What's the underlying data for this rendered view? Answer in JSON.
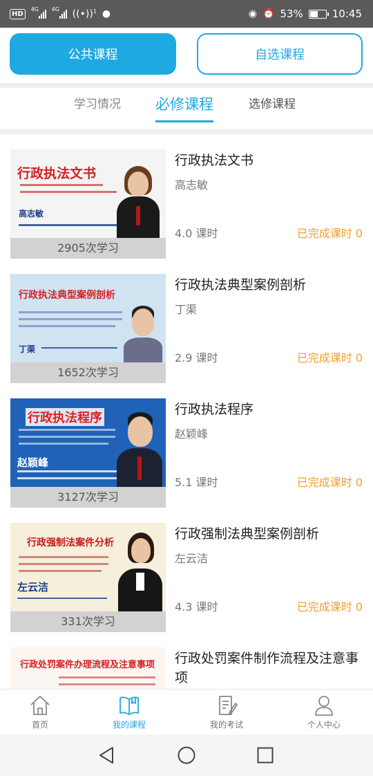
{
  "status_bar": {
    "hd_label": "HD",
    "network_1": "4G",
    "network_2": "4G",
    "hotspot_count": "1",
    "battery": "53%",
    "battery_level": 0.53,
    "time": "10:45"
  },
  "top_toggle": {
    "public_label": "公共课程",
    "custom_label": "自选课程"
  },
  "sub_tabs": {
    "study": "学习情况",
    "required": "必修课程",
    "elective": "选修课程",
    "active": "required"
  },
  "courses": [
    {
      "title": "行政执法文书",
      "author": "高志敏",
      "hours": "4.0 课时",
      "completed": "已完成课时 0",
      "study_count": "2905次学习",
      "banner": {
        "heading": "行政执法文书",
        "name": "高志敏",
        "bg": "#f4f4f4",
        "heading_color": "#d42020"
      }
    },
    {
      "title": "行政执法典型案例剖析",
      "author": "丁渠",
      "hours": "2.9 课时",
      "completed": "已完成课时 0",
      "study_count": "1652次学习",
      "banner": {
        "heading": "行政执法典型案例剖析",
        "name": "丁渠",
        "bg": "#cfe3f1",
        "heading_color": "#d42020"
      }
    },
    {
      "title": "行政执法程序",
      "author": "赵颖峰",
      "hours": "5.1 课时",
      "completed": "已完成课时 0",
      "study_count": "3127次学习",
      "banner": {
        "heading": "行政执法程序",
        "name": "赵颖峰",
        "bg": "#1f62b8",
        "heading_color": "#e02020"
      }
    },
    {
      "title": "行政强制法典型案例剖析",
      "author": "左云洁",
      "hours": "4.3 课时",
      "completed": "已完成课时 0",
      "study_count": "331次学习",
      "banner": {
        "heading": "行政强制法案件分析",
        "name": "左云洁",
        "bg": "#f6efdc",
        "heading_color": "#c41a1a"
      }
    },
    {
      "title": "行政处罚案件制作流程及注意事项",
      "author": "",
      "hours": "",
      "completed": "",
      "study_count": "",
      "banner": {
        "heading": "行政处罚案件办理流程及注意事项",
        "name": "",
        "bg": "#fbf6f2",
        "heading_color": "#d42020"
      }
    }
  ],
  "bottom_nav": [
    {
      "label": "首页",
      "icon": "home-icon",
      "active": false
    },
    {
      "label": "我的课程",
      "icon": "book-icon",
      "active": true
    },
    {
      "label": "我的考试",
      "icon": "exam-icon",
      "active": false
    },
    {
      "label": "个人中心",
      "icon": "user-icon",
      "active": false
    }
  ],
  "system_nav": {
    "back_icon": "back-triangle-icon",
    "home_icon": "home-circle-icon",
    "recent_icon": "recent-square-icon"
  },
  "colors": {
    "accent": "#1fa9e1",
    "completed": "#f0a030",
    "status_bar": "#5a5a5a"
  }
}
